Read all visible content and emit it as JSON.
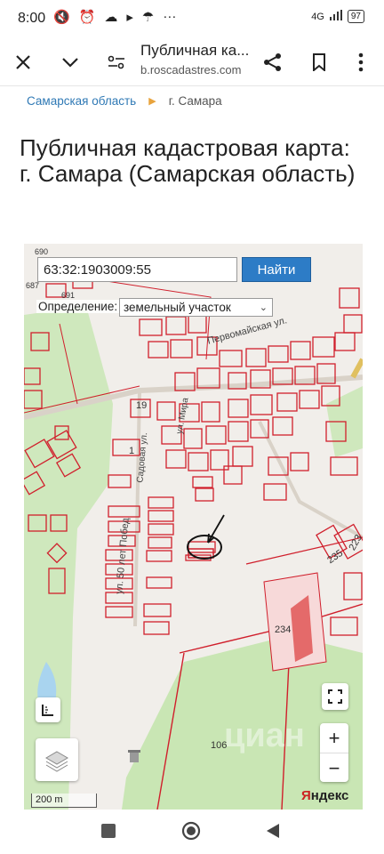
{
  "status_bar": {
    "time": "8:00",
    "network": "4G",
    "battery": "97"
  },
  "browser": {
    "title": "Публичная ка...",
    "url": "b.roscadastres.com",
    "icons": [
      "close-icon",
      "chevron-down-icon",
      "site-settings-icon",
      "share-icon",
      "bookmark-icon",
      "more-icon"
    ]
  },
  "breadcrumb": {
    "items": [
      "Самарская область",
      "г. Самара"
    ]
  },
  "page": {
    "heading": "Публичная кадастровая карта: г. Самара (Самарская область)"
  },
  "map": {
    "search": {
      "value": "63:32:1903009:55",
      "button": "Найти"
    },
    "definition": {
      "label": "Определение:",
      "selected": "земельный участок"
    },
    "parcel_labels": [
      "690",
      "687",
      "691",
      "19",
      "1",
      "235",
      "223",
      "234",
      "106"
    ],
    "street_labels": [
      "Первомайская ул.",
      "ул. 50 лет Побед",
      "Садовая ул.",
      "ул. Мира"
    ],
    "scale": "200 m",
    "provider": {
      "brand_red": "Я",
      "brand_rest": "ндекс"
    },
    "controls": [
      "ruler-icon",
      "layers-icon",
      "fullscreen-icon",
      "zoom-in-button",
      "zoom-out-button"
    ]
  },
  "colors": {
    "parcel": "#d01f2c",
    "link": "#2f79b5",
    "button": "#2d7cc6",
    "map_bg": "#f1eeea",
    "forest": "#c9e6b4"
  }
}
